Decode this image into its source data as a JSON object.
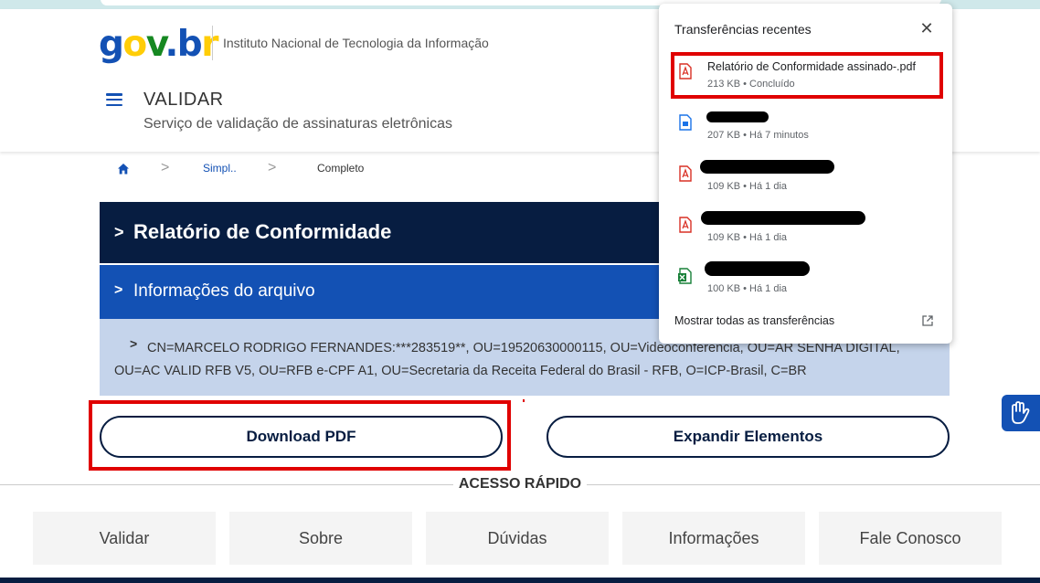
{
  "header": {
    "logo": {
      "g": "g",
      "o": "o",
      "v": "v",
      "dot": ".",
      "b": "b",
      "r": "r"
    },
    "org_name": "Instituto Nacional de Tecnologia da Informação",
    "page_title": "VALIDAR",
    "page_subtitle": "Serviço de validação de assinaturas eletrônicas"
  },
  "breadcrumb": {
    "link": "Simpl..",
    "current": "Completo",
    "separator": ">"
  },
  "sections": {
    "report_title": "Relatório de Conformidade",
    "file_info": "Informações do arquivo",
    "signer": "CN=MARCELO RODRIGO FERNANDES:***283519**, OU=19520630000115, OU=Videoconferencia, OU=AR SENHA DIGITAL, OU=AC VALID RFB V5, OU=RFB e-CPF A1, OU=Secretaria da Receita Federal do Brasil - RFB, O=ICP-Brasil, C=BR",
    "chevron": ">"
  },
  "buttons": {
    "download": "Download PDF",
    "expand": "Expandir Elementos"
  },
  "quick_access": {
    "title": "ACESSO RÁPIDO",
    "tiles": [
      "Validar",
      "Sobre",
      "Dúvidas",
      "Informações",
      "Fale Conosco"
    ]
  },
  "downloads_popup": {
    "title": "Transferências recentes",
    "close": "✕",
    "show_all": "Mostrar todas as  transferências",
    "items": [
      {
        "name": "Relatório de Conformidade assinado-.pdf",
        "meta": "213 KB • Concluído",
        "icon": "pdf-icon"
      },
      {
        "name": "",
        "meta": "207 KB • Há 7 minutos",
        "icon": "doc-icon"
      },
      {
        "name": "",
        "meta": "109 KB • Há 1 dia",
        "icon": "pdf-icon"
      },
      {
        "name": "",
        "meta": "109 KB • Há 1 dia",
        "icon": "pdf-icon"
      },
      {
        "name": "",
        "meta": "100 KB • Há 1 dia",
        "icon": "excel-icon"
      }
    ]
  },
  "colors": {
    "brand_blue": "#1351b4",
    "dark_navy": "#071d41",
    "light_blue": "#c5d4eb",
    "highlight_red": "#e00000"
  }
}
